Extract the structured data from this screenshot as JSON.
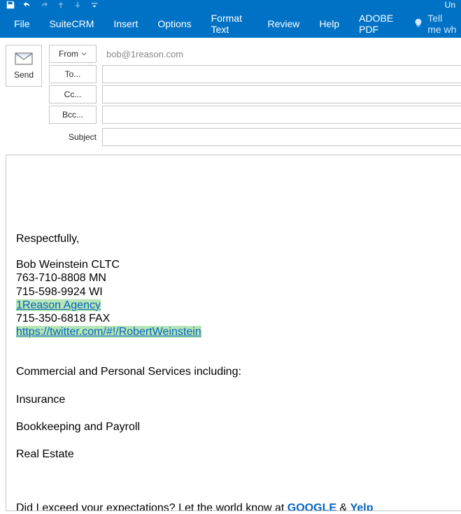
{
  "titlebar": {
    "right_text": "Un"
  },
  "ribbon": {
    "tabs": [
      "File",
      "SuiteCRM",
      "Insert",
      "Options",
      "Format Text",
      "Review",
      "Help",
      "ADOBE PDF"
    ],
    "tell_me": "Tell me wh"
  },
  "compose": {
    "send": "Send",
    "from_label": "From",
    "from_value": "bob@1reason.com",
    "to_label": "To...",
    "cc_label": "Cc...",
    "bcc_label": "Bcc...",
    "subject_label": "Subject",
    "to_value": "",
    "cc_value": "",
    "bcc_value": "",
    "subject_value": ""
  },
  "body": {
    "greeting": "Respectfully,",
    "name": "Bob Weinstein CLTC",
    "phone1": "763-710-8808 MN",
    "phone2": "715-598-9924 WI",
    "agency_link": "1Reason Agency",
    "fax": "715-350-6818 FAX",
    "twitter": "https://twitter.com/#!/RobertWeinstein",
    "services_heading": "Commercial and Personal Services including:",
    "svc1": "Insurance",
    "svc2": "Bookkeeping and Payroll",
    "svc3": "Real Estate",
    "review_pre": "Did I exceed your expectations? Let the world know at ",
    "google": "GOOGLE",
    "amp": " & ",
    "yelp": "Yelp"
  }
}
